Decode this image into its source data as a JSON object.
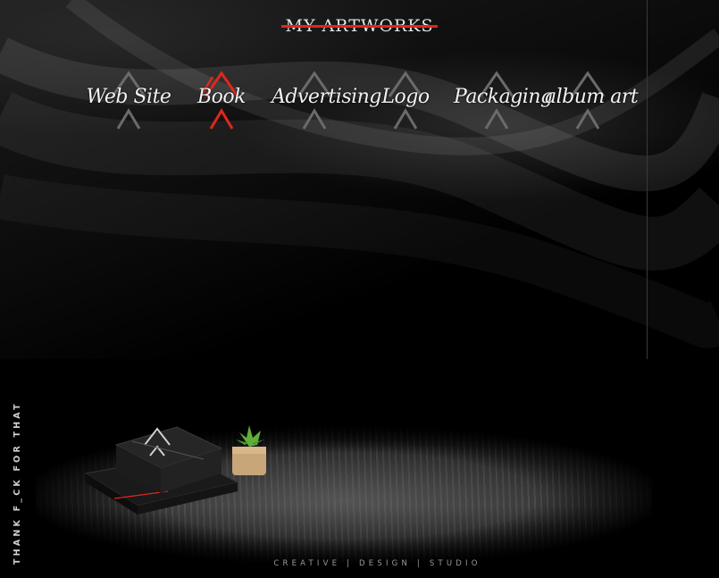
{
  "brand": {
    "logo_text": "MY ARTWORKS"
  },
  "nav": {
    "items": [
      {
        "label": "Web Site"
      },
      {
        "label": "Book",
        "active": true
      },
      {
        "label": "Advertising"
      },
      {
        "label": "Logo"
      },
      {
        "label": "Packaging"
      },
      {
        "label": "album art"
      }
    ]
  },
  "sidebar": {
    "vertical_text": "THANK F_CK FOR THAT"
  },
  "footer": {
    "tagline": "CREATIVE | DESIGN | STUDIO"
  },
  "colors": {
    "accent": "#e0271d",
    "background": "#000000",
    "nav_icon_inactive": "#6b6b6b"
  }
}
